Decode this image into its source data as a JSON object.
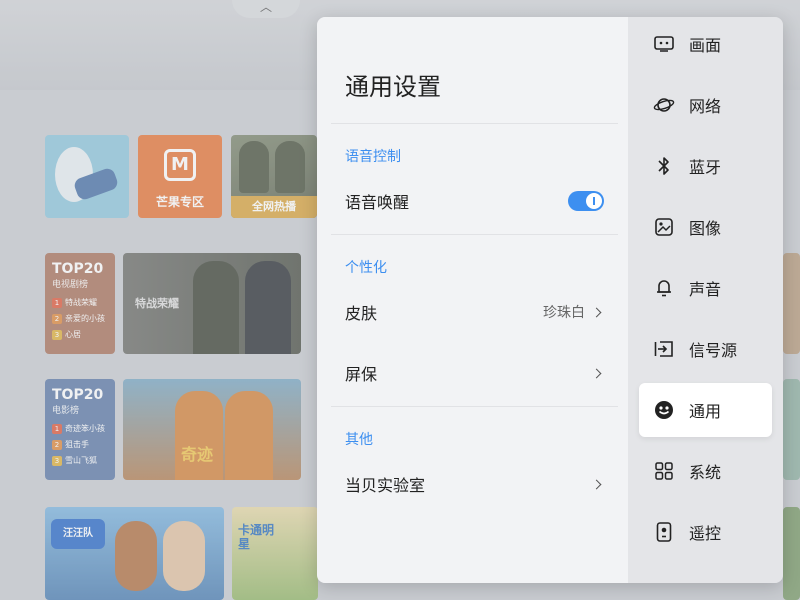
{
  "background": {
    "tiles": {
      "app2_logo": "M",
      "app2_caption": "芒果专区",
      "app3_caption": "全网热播",
      "poster1_text": "特战荣耀",
      "poster2_text": "奇迹",
      "kids1_logo": "汪汪队",
      "kids2_text": "卡通明星"
    },
    "rank_tv": {
      "title": "TOP20",
      "subtitle": "电视剧榜",
      "items": [
        {
          "num": "1",
          "name": "特战荣耀"
        },
        {
          "num": "2",
          "name": "亲爱的小孩"
        },
        {
          "num": "3",
          "name": "心居"
        }
      ]
    },
    "rank_movie": {
      "title": "TOP20",
      "subtitle": "电影榜",
      "items": [
        {
          "num": "1",
          "name": "奇迹笨小孩"
        },
        {
          "num": "2",
          "name": "狙击手"
        },
        {
          "num": "3",
          "name": "雪山飞狐"
        }
      ]
    }
  },
  "settings": {
    "title": "通用设置",
    "sections": [
      {
        "label": "语音控制"
      },
      {
        "label": "个性化"
      },
      {
        "label": "其他"
      }
    ],
    "rows": {
      "voice_wake": {
        "label": "语音唤醒",
        "toggle_on": true
      },
      "skin": {
        "label": "皮肤",
        "value": "珍珠白"
      },
      "screensaver": {
        "label": "屏保"
      },
      "lab": {
        "label": "当贝实验室"
      }
    }
  },
  "nav": {
    "items": [
      {
        "label": "画面",
        "icon": "picture-mode-icon"
      },
      {
        "label": "网络",
        "icon": "network-planet-icon"
      },
      {
        "label": "蓝牙",
        "icon": "bluetooth-icon"
      },
      {
        "label": "图像",
        "icon": "image-icon"
      },
      {
        "label": "声音",
        "icon": "bell-sound-icon"
      },
      {
        "label": "信号源",
        "icon": "signal-source-icon"
      },
      {
        "label": "通用",
        "icon": "smiley-icon",
        "active": true
      },
      {
        "label": "系统",
        "icon": "grid-system-icon"
      },
      {
        "label": "遥控",
        "icon": "remote-control-icon"
      }
    ]
  },
  "colors": {
    "accent": "#3d8ff0",
    "pane_bg": "#f2f3f5",
    "nav_bg": "#e4e5e8",
    "active_bg": "#ffffff"
  }
}
